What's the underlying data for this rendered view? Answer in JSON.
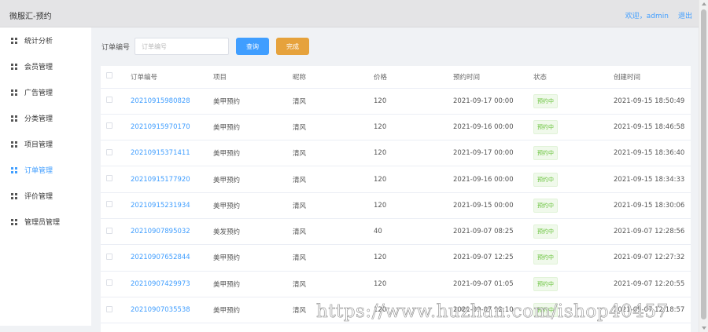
{
  "header": {
    "title": "微服汇-预约",
    "welcome": "欢迎，admin",
    "logout": "退出"
  },
  "sidebar": {
    "items": [
      {
        "label": "统计分析",
        "active": false
      },
      {
        "label": "会员管理",
        "active": false
      },
      {
        "label": "广告管理",
        "active": false
      },
      {
        "label": "分类管理",
        "active": false
      },
      {
        "label": "项目管理",
        "active": false
      },
      {
        "label": "订单管理",
        "active": true
      },
      {
        "label": "评价管理",
        "active": false
      },
      {
        "label": "管理员管理",
        "active": false
      }
    ]
  },
  "filter": {
    "label": "订单编号",
    "placeholder": "订单编号",
    "value": "",
    "search_button": "查询",
    "done_button": "完成"
  },
  "table": {
    "columns": [
      "订单编号",
      "项目",
      "昵称",
      "价格",
      "预约时间",
      "状态",
      "创建时间"
    ],
    "rows": [
      {
        "order_no": "20210915980828",
        "project": "美甲预约",
        "nickname": "清风",
        "price": "120",
        "appointment": "2021-09-17 00:00",
        "status": "预约中",
        "created": "2021-09-15 18:50:49"
      },
      {
        "order_no": "20210915970170",
        "project": "美甲预约",
        "nickname": "清风",
        "price": "120",
        "appointment": "2021-09-16 00:00",
        "status": "预约中",
        "created": "2021-09-15 18:46:58"
      },
      {
        "order_no": "20210915371411",
        "project": "美甲预约",
        "nickname": "清风",
        "price": "120",
        "appointment": "2021-09-17 00:00",
        "status": "预约中",
        "created": "2021-09-15 18:36:40"
      },
      {
        "order_no": "20210915177920",
        "project": "美甲预约",
        "nickname": "清风",
        "price": "120",
        "appointment": "2021-09-16 00:00",
        "status": "预约中",
        "created": "2021-09-15 18:34:33"
      },
      {
        "order_no": "20210915231934",
        "project": "美甲预约",
        "nickname": "清风",
        "price": "120",
        "appointment": "2021-09-15 00:00",
        "status": "预约中",
        "created": "2021-09-15 18:30:06"
      },
      {
        "order_no": "20210907895032",
        "project": "美发预约",
        "nickname": "清风",
        "price": "40",
        "appointment": "2021-09-07 08:25",
        "status": "预约中",
        "created": "2021-09-07 12:28:56"
      },
      {
        "order_no": "20210907652844",
        "project": "美甲预约",
        "nickname": "清风",
        "price": "120",
        "appointment": "2021-09-07 12:25",
        "status": "预约中",
        "created": "2021-09-07 12:27:32"
      },
      {
        "order_no": "20210907429973",
        "project": "美甲预约",
        "nickname": "清风",
        "price": "120",
        "appointment": "2021-09-07 01:05",
        "status": "预约中",
        "created": "2021-09-07 12:20:55"
      },
      {
        "order_no": "20210907035538",
        "project": "美甲预约",
        "nickname": "清风",
        "price": "120",
        "appointment": "2021-09-07 12:10",
        "status": "预约中",
        "created": "2021-09-07 12:18:57"
      }
    ]
  },
  "watermark": "https://www.huzhan.com/ishop40457",
  "colors": {
    "accent": "#409eff",
    "warning": "#e6a23c",
    "status_text": "#67c23a",
    "status_bg": "#f0f9eb"
  }
}
